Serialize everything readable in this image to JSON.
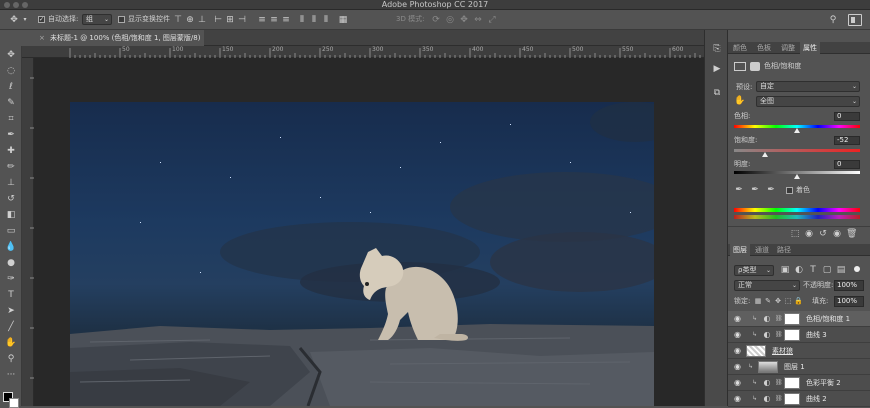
{
  "app": {
    "title": "Adobe Photoshop CC 2017"
  },
  "options_bar": {
    "auto_select_label": "自动选择:",
    "auto_select_target": "组",
    "show_transform_label": "显示变换控件",
    "mode_3d_label": "3D 模式:"
  },
  "document": {
    "tab_title": "未标题-1 @ 100% (色相/饱和度 1, 图层蒙版/8) *"
  },
  "ruler": {
    "top_ticks": [
      "50",
      "100",
      "150",
      "200",
      "250",
      "300",
      "350",
      "400",
      "450",
      "500",
      "550",
      "600",
      "650"
    ]
  },
  "properties_panel": {
    "tabs": [
      "颜色",
      "色板",
      "调整",
      "属性"
    ],
    "active_tab": "属性",
    "adjustment_name": "色相/饱和度",
    "preset_label": "预设:",
    "preset_value": "自定",
    "channel_value": "全图",
    "hue_label": "色相:",
    "hue_value": "0",
    "saturation_label": "饱和度:",
    "saturation_value": "-52",
    "lightness_label": "明度:",
    "lightness_value": "0",
    "colorize_label": "着色"
  },
  "layers_panel": {
    "tabs": [
      "图层",
      "通道",
      "路径"
    ],
    "active_tab": "图层",
    "filter_label": "ρ类型",
    "blend_mode": "正常",
    "opacity_label": "不透明度:",
    "opacity_value": "100%",
    "lock_label": "锁定:",
    "fill_label": "填充:",
    "fill_value": "100%",
    "layers": [
      {
        "name": "色相/饱和度 1",
        "selected": true
      },
      {
        "name": "曲线 3",
        "selected": false
      },
      {
        "name": "素材狼",
        "selected": false
      },
      {
        "name": "图层 1",
        "selected": false
      },
      {
        "name": "色彩平衡 2",
        "selected": false
      },
      {
        "name": "曲线 2",
        "selected": false
      }
    ]
  },
  "colors": {
    "accent": "#1473e6",
    "canvas_sky": "#1d3a60",
    "panel_bg": "#535353"
  }
}
